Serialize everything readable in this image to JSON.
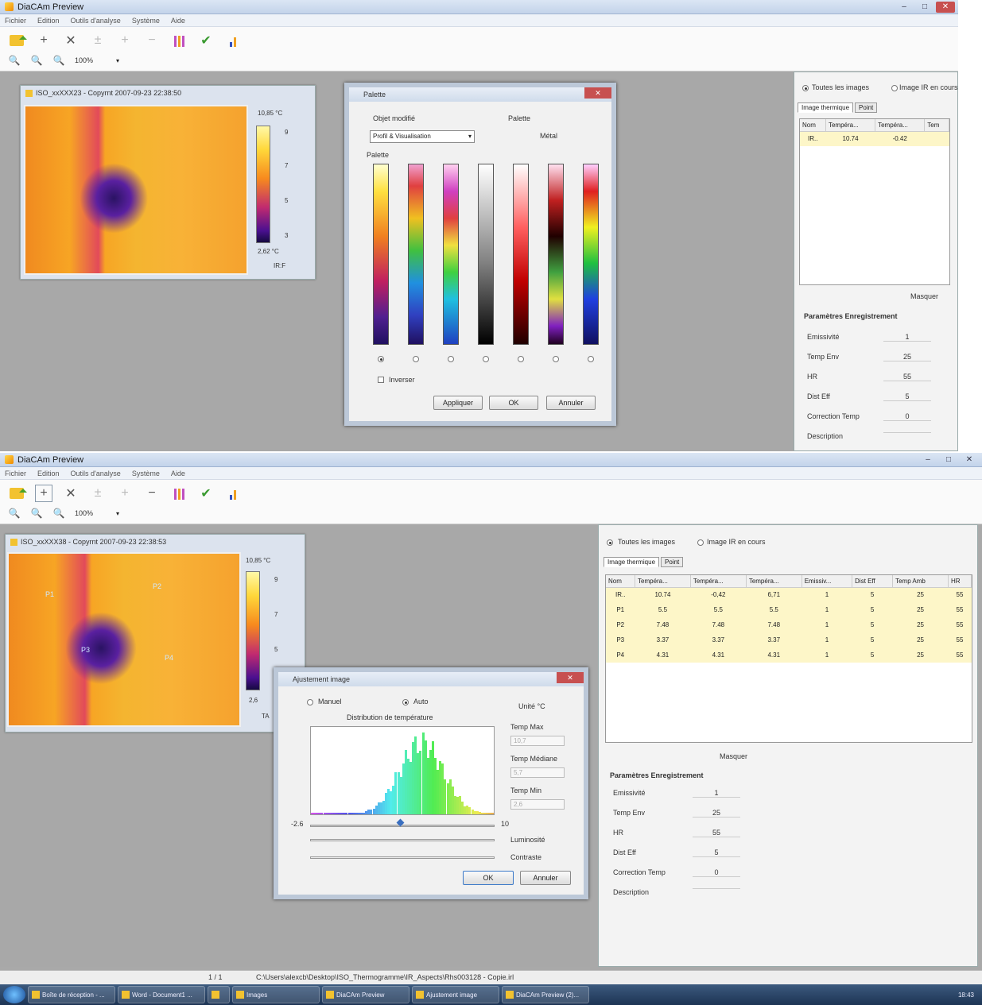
{
  "shot1": {
    "window_title": "DiaCAm Preview",
    "menu": [
      "Fichier",
      "Edition",
      "Outils d'analyse",
      "Système",
      "Aide"
    ],
    "zoom": "100%",
    "image_window": {
      "title": "ISO_xxXXX23 - Copyrnt 2007-09-23 22:38:50",
      "scale_max": "10,85 °C",
      "scale_min": "2,62 °C",
      "scale_ticks": [
        "9",
        "7",
        "5",
        "3"
      ],
      "footer": "IR:F"
    },
    "palette_dialog": {
      "title": "Palette",
      "objet_label": "Objet modifié",
      "palette_label": "Palette",
      "objet_value": "Profil & Visualisation",
      "palette_value": "Métal",
      "section_label": "Palette",
      "invert_label": "Inverser",
      "buttons": [
        "Appliquer",
        "OK",
        "Annuler"
      ]
    },
    "side": {
      "radio_all": "Toutes les images",
      "radio_current": "Image IR en cours",
      "tabs": [
        "Image thermique",
        "Point"
      ],
      "columns": [
        "Nom",
        "Tempéra...",
        "Tempéra...",
        "Tem"
      ],
      "rows": [
        [
          "IR..",
          "10.74",
          "-0.42",
          ""
        ]
      ],
      "masquer": "Masquer",
      "params_title": "Paramètres Enregistrement",
      "params": [
        {
          "label": "Emissivité",
          "value": "1"
        },
        {
          "label": "Temp Env",
          "value": "25"
        },
        {
          "label": "HR",
          "value": "55"
        },
        {
          "label": "Dist Eff",
          "value": "5"
        },
        {
          "label": "Correction Temp",
          "value": "0"
        },
        {
          "label": "Description",
          "value": ""
        }
      ]
    }
  },
  "shot2": {
    "window_title": "DiaCAm Preview",
    "menu": [
      "Fichier",
      "Edition",
      "Outils d'analyse",
      "Système",
      "Aide"
    ],
    "zoom": "100%",
    "image_window": {
      "title": "ISO_xxXXX38 - Copyrnt 2007-09-23 22:38:53",
      "scale_max": "10,85 °C",
      "scale_min": "2,6",
      "scale_ticks": [
        "9",
        "7",
        "5"
      ],
      "footer": "TA",
      "spot_labels": [
        "P1",
        "P2",
        "P3",
        "P4"
      ]
    },
    "adjust_dialog": {
      "title": "Ajustement image",
      "manual": "Manuel",
      "auto": "Auto",
      "dist_title": "Distribution de température",
      "unit": "Unité °C",
      "temp_max_label": "Temp Max",
      "temp_max_val": "10,7",
      "temp_med_label": "Temp Médiane",
      "temp_med_val": "5,7",
      "temp_min_label": "Temp Min",
      "temp_min_val": "2,6",
      "axis_min": "-2.6",
      "axis_max": "10",
      "luminosite": "Luminosité",
      "contraste": "Contraste",
      "buttons": [
        "OK",
        "Annuler"
      ]
    },
    "side": {
      "radio_all": "Toutes les images",
      "radio_current": "Image IR en cours",
      "tabs": [
        "Image thermique",
        "Point"
      ],
      "columns": [
        "Nom",
        "Tempéra...",
        "Tempéra...",
        "Tempéra...",
        "Emissiv...",
        "Dist Eff",
        "Temp Amb",
        "HR"
      ],
      "rows": [
        [
          "IR..",
          "10.74",
          "-0,42",
          "6,71",
          "1",
          "5",
          "25",
          "55"
        ],
        [
          "P1",
          "5.5",
          "5.5",
          "5.5",
          "1",
          "5",
          "25",
          "55"
        ],
        [
          "P2",
          "7.48",
          "7.48",
          "7.48",
          "1",
          "5",
          "25",
          "55"
        ],
        [
          "P3",
          "3.37",
          "3.37",
          "3.37",
          "1",
          "5",
          "25",
          "55"
        ],
        [
          "P4",
          "4.31",
          "4.31",
          "4.31",
          "1",
          "5",
          "25",
          "55"
        ]
      ],
      "masquer": "Masquer",
      "params_title": "Paramètres Enregistrement",
      "params": [
        {
          "label": "Emissivité",
          "value": "1"
        },
        {
          "label": "Temp Env",
          "value": "25"
        },
        {
          "label": "HR",
          "value": "55"
        },
        {
          "label": "Dist Eff",
          "value": "5"
        },
        {
          "label": "Correction Temp",
          "value": "0"
        },
        {
          "label": "Description",
          "value": ""
        }
      ]
    },
    "status": {
      "page": "1 / 1",
      "path": "C:\\Users\\alexcb\\Desktop\\ISO_Thermogramme\\IR_Aspects\\Rhs003128 - Copie.irl"
    },
    "taskbar": [
      "Boîte de réception - ...",
      "Word - Document1 ...",
      "",
      "Images",
      "DiaCAm Preview",
      "Ajustement image",
      "DiaCAm Preview (2)..."
    ],
    "clock": "18:43"
  }
}
